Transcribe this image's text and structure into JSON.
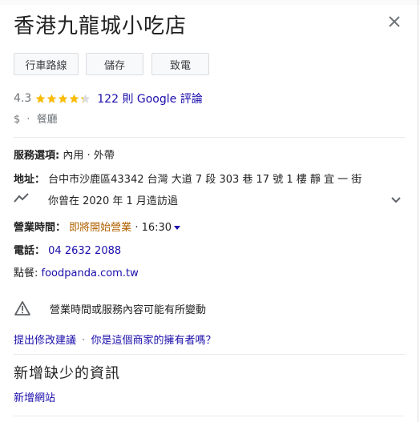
{
  "place": {
    "title": "香港九龍城小吃店"
  },
  "actions": {
    "directions": "行車路線",
    "save": "儲存",
    "call": "致電"
  },
  "rating": {
    "value": "4.3",
    "stars": 4.3,
    "reviews": "122 則 Google 評論"
  },
  "category": {
    "price": "$",
    "sep": "·",
    "type": "餐廳"
  },
  "service": {
    "label": "服務選項:",
    "value": "內用 · 外帶"
  },
  "address": {
    "label": "地址：",
    "value": "台中市沙鹿區43342 台灣 大道 7 段 303 巷 17 號 1 樓 靜 宜 一 街"
  },
  "visit": {
    "text": "你曾在 2020 年 1 月造訪過"
  },
  "hours": {
    "label": "營業時間：",
    "status": "即將開始營業",
    "time": "· 16:30"
  },
  "phone": {
    "label": "電話：",
    "value": "04 2632 2088"
  },
  "order": {
    "label": "點餐:",
    "value": "foodpanda.com.tw"
  },
  "notice": {
    "text": "營業時間或服務內容可能有所變動"
  },
  "suggest": {
    "edit": "提出修改建議",
    "sep": "·",
    "owner": "你是這個商家的擁有者嗎？"
  },
  "missing": {
    "title": "新增缺少的資訊",
    "add_website": "新增網站"
  },
  "colors": {
    "star": "#fbbc04",
    "link": "#1a0dab",
    "status": "#b06000"
  }
}
